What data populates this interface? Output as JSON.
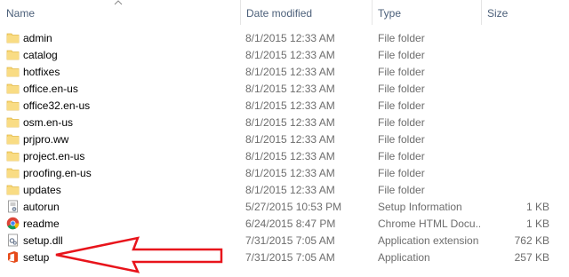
{
  "columns": {
    "name": "Name",
    "date": "Date modified",
    "type": "Type",
    "size": "Size"
  },
  "files": [
    {
      "name": "admin",
      "date": "8/1/2015 12:33 AM",
      "type": "File folder",
      "size": "",
      "icon": "folder-icon"
    },
    {
      "name": "catalog",
      "date": "8/1/2015 12:33 AM",
      "type": "File folder",
      "size": "",
      "icon": "folder-icon"
    },
    {
      "name": "hotfixes",
      "date": "8/1/2015 12:33 AM",
      "type": "File folder",
      "size": "",
      "icon": "folder-icon"
    },
    {
      "name": "office.en-us",
      "date": "8/1/2015 12:33 AM",
      "type": "File folder",
      "size": "",
      "icon": "folder-icon"
    },
    {
      "name": "office32.en-us",
      "date": "8/1/2015 12:33 AM",
      "type": "File folder",
      "size": "",
      "icon": "folder-icon"
    },
    {
      "name": "osm.en-us",
      "date": "8/1/2015 12:33 AM",
      "type": "File folder",
      "size": "",
      "icon": "folder-icon"
    },
    {
      "name": "prjpro.ww",
      "date": "8/1/2015 12:33 AM",
      "type": "File folder",
      "size": "",
      "icon": "folder-icon"
    },
    {
      "name": "project.en-us",
      "date": "8/1/2015 12:33 AM",
      "type": "File folder",
      "size": "",
      "icon": "folder-icon"
    },
    {
      "name": "proofing.en-us",
      "date": "8/1/2015 12:33 AM",
      "type": "File folder",
      "size": "",
      "icon": "folder-icon"
    },
    {
      "name": "updates",
      "date": "8/1/2015 12:33 AM",
      "type": "File folder",
      "size": "",
      "icon": "folder-icon"
    },
    {
      "name": "autorun",
      "date": "5/27/2015 10:53 PM",
      "type": "Setup Information",
      "size": "1 KB",
      "icon": "setup-info-icon"
    },
    {
      "name": "readme",
      "date": "6/24/2015 8:47 PM",
      "type": "Chrome HTML Docu...",
      "size": "1 KB",
      "icon": "chrome-icon"
    },
    {
      "name": "setup.dll",
      "date": "7/31/2015 7:05 AM",
      "type": "Application extension",
      "size": "762 KB",
      "icon": "dll-icon"
    },
    {
      "name": "setup",
      "date": "7/31/2015 7:05 AM",
      "type": "Application",
      "size": "257 KB",
      "icon": "office-setup-icon"
    }
  ],
  "colors": {
    "header_text": "#4c607a",
    "folder": "#f8d775",
    "arrow": "#e8141b"
  }
}
